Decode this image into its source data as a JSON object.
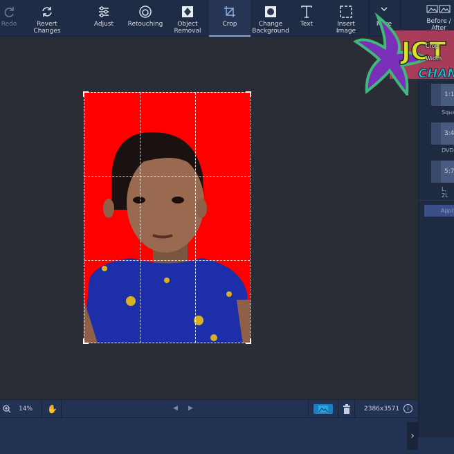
{
  "toolbar": {
    "items": [
      {
        "label": "Redo",
        "icon": "redo-icon",
        "state": "disabled"
      },
      {
        "label": "Revert Changes",
        "icon": "revert-icon"
      },
      {
        "label": "Adjust",
        "icon": "sliders-icon"
      },
      {
        "label": "Retouching",
        "icon": "retouch-face-icon"
      },
      {
        "label": "Object Removal",
        "icon": "object-removal-icon"
      },
      {
        "label": "Crop",
        "icon": "crop-icon",
        "state": "active"
      },
      {
        "label": "Change Background",
        "icon": "change-background-icon"
      },
      {
        "label": "Text",
        "icon": "text-icon"
      },
      {
        "label": "Insert Image",
        "icon": "insert-image-icon"
      },
      {
        "label": "More",
        "icon": "chevron-down-icon"
      },
      {
        "label": "Before / After",
        "icon": "before-after-icon"
      }
    ]
  },
  "right_panel": {
    "title": "Crop",
    "width_label": "Width",
    "presets": [
      {
        "ratio": "1:1",
        "label": "Square"
      },
      {
        "ratio": "3:4",
        "label": "DVD"
      },
      {
        "ratio": "5:7",
        "label": "L, 2L"
      }
    ],
    "apply_label": "Apply"
  },
  "bottom_bar": {
    "zoom": "14%",
    "dimensions": "2386x3571"
  },
  "watermark": {
    "line1": "JCT",
    "line2": "CHAN"
  },
  "colors": {
    "toolbar": "#1f2c45",
    "canvas": "#2a2d35",
    "photo_background": "#ff0000",
    "accent": "#2aa8e0"
  }
}
